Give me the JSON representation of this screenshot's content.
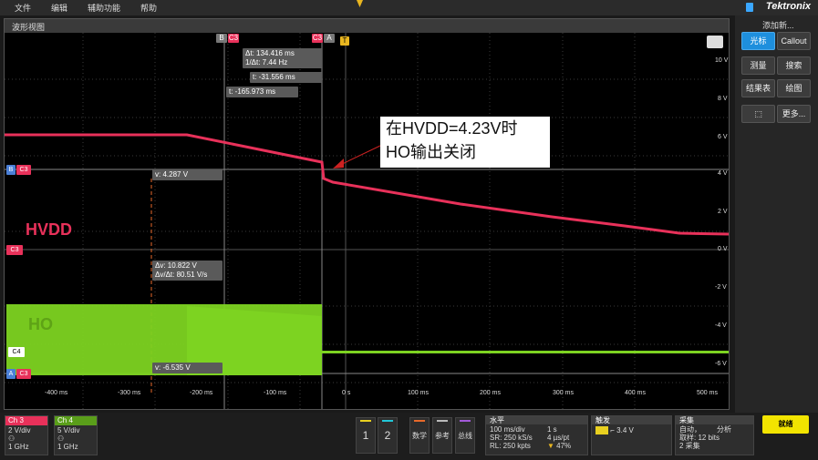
{
  "menu": {
    "items": [
      "文件",
      "编辑",
      "辅助功能",
      "帮助"
    ],
    "brand": "Tektronix"
  },
  "waveform_window": {
    "title": "波形视图"
  },
  "y_axis_labels": [
    "10 V",
    "8 V",
    "6 V",
    "4 V",
    "2 V",
    "0 V",
    "-2 V",
    "-4 V",
    "-6 V"
  ],
  "x_axis_labels": [
    "-400 ms",
    "-300 ms",
    "-200 ms",
    "-100 ms",
    "0 s",
    "100 ms",
    "200 ms",
    "300 ms",
    "400 ms",
    "500 ms"
  ],
  "cursor_readouts": {
    "delta_t": "Δt: 134.416 ms",
    "inv_delta_t": "1/Δt: 7.44 Hz",
    "t_a": "t: -31.556 ms",
    "t_b": "t: -165.973 ms",
    "v_top": "v: 4.287 V",
    "delta_v": "Δv: 10.822 V",
    "dv_dt": "Δv/Δt: 80.51 V/s",
    "v_bottom": "v: -6.535 V"
  },
  "marker_tags": {
    "b": "B",
    "c3": "C3",
    "a": "A",
    "t": "T",
    "c4": "C4"
  },
  "trace_names": {
    "hvdd": "HVDD",
    "ho": "HO"
  },
  "annotation": {
    "line1": "在HVDD=4.23V时",
    "line2": "HO输出关闭"
  },
  "side_panel": {
    "heading": "添加新...",
    "buttons": [
      "光标",
      "Callout",
      "测量",
      "搜索",
      "结果表",
      "绘图",
      "更多..."
    ]
  },
  "bottom": {
    "ch3": {
      "name": "Ch 3",
      "scale": "2 V/div",
      "bw": "1 GHz"
    },
    "ch4": {
      "name": "Ch 4",
      "scale": "5 V/div",
      "bw": "1 GHz"
    },
    "soft_buttons": [
      "1",
      "2",
      "数学",
      "参考",
      "总线"
    ],
    "horizontal": {
      "title": "水平",
      "scale": "100 ms/div",
      "duration": "1 s",
      "sr": "SR: 250 kS/s",
      "pt": "4 µs/pt",
      "rl": "RL: 250 kpts",
      "pos": "47%"
    },
    "trigger": {
      "title": "触发",
      "level": "3.4 V"
    },
    "acquisition": {
      "title": "采集",
      "mode": "自动，",
      "analyze": "分析",
      "sampling": "取样: 12 bits",
      "acqs": "2 采集"
    },
    "ready": "就绪"
  },
  "colors": {
    "ch3": "#e8315a",
    "ch4": "#7dd321",
    "accent": "#1e8fdd"
  }
}
